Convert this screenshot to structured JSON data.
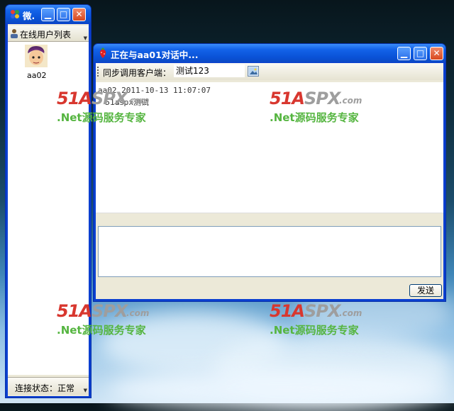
{
  "left_window": {
    "title": "微.",
    "section_header": "在线用户列表",
    "users": [
      {
        "name": "aa02"
      }
    ],
    "status_label": "连接状态：",
    "status_value": "正常"
  },
  "chat_window": {
    "title": "正在与aa01对话中...",
    "toolbar_label": "同步调用客户端：",
    "client_value": "测试123",
    "messages": [
      {
        "header": "aa02 2011-10-13 11:07:07",
        "text": "51aspx测试"
      }
    ],
    "input_value": "",
    "send_label": "发送"
  },
  "watermark": {
    "brand_red": "51A",
    "brand_gray": "SPX",
    "domain": ".com",
    "tagline": ".Net源码服务专家"
  }
}
